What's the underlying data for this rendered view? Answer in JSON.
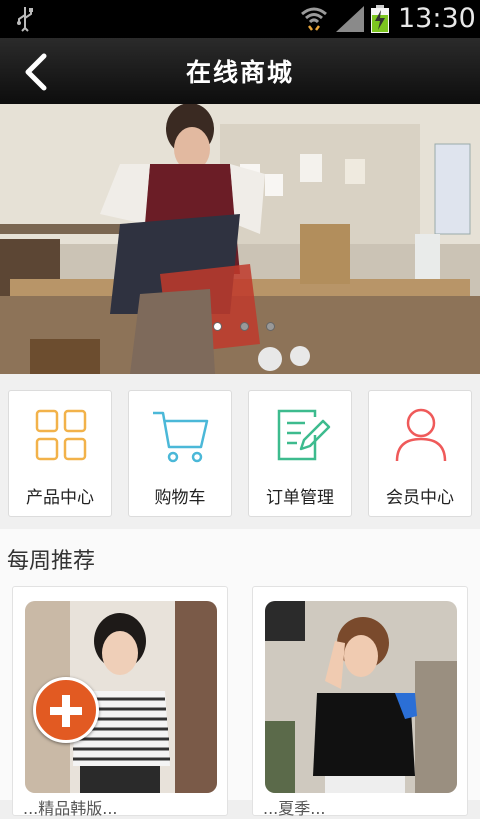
{
  "status_bar": {
    "time": "13:30",
    "icons": [
      "usb-icon",
      "wifi-icon",
      "signal-icon",
      "battery-charging-icon"
    ]
  },
  "header": {
    "title": "在线商城",
    "back_icon": "chevron-left-icon"
  },
  "banner": {
    "image": "tailor working at workbench",
    "slide_count": 3,
    "active_slide": 1
  },
  "quick_links": [
    {
      "label": "产品中心",
      "icon": "grid-icon",
      "color": "#f2b24a"
    },
    {
      "label": "购物车",
      "icon": "cart-icon",
      "color": "#4bb8d8"
    },
    {
      "label": "订单管理",
      "icon": "order-edit-icon",
      "color": "#3dbb8e"
    },
    {
      "label": "会员中心",
      "icon": "user-icon",
      "color": "#ef5a5a"
    }
  ],
  "weekly": {
    "heading": "每周推荐",
    "items": [
      {
        "name": "...精品韩版...",
        "image": "man in striped t-shirt"
      },
      {
        "name": "...夏季...",
        "image": "man in black polo shirt"
      }
    ]
  },
  "fab": {
    "icon": "plus-icon",
    "color": "#e25a22"
  }
}
